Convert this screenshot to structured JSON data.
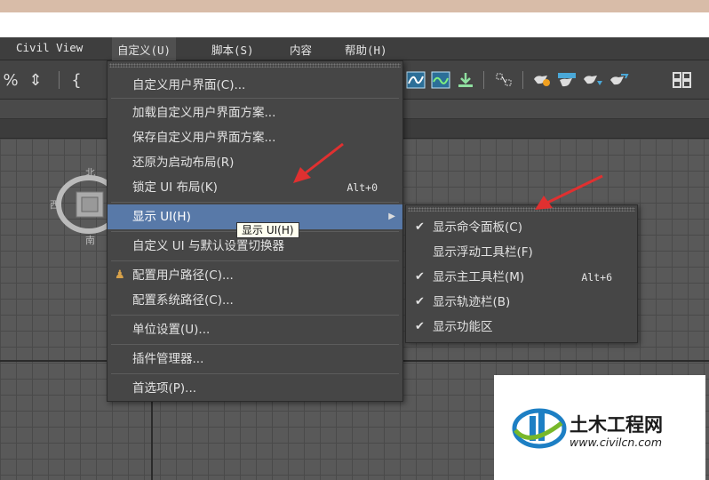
{
  "menubar": {
    "items": [
      {
        "label": "Civil View"
      },
      {
        "label": "自定义(U)"
      },
      {
        "label": "脚本(S)"
      },
      {
        "label": "内容"
      },
      {
        "label": "帮助(H)"
      }
    ]
  },
  "viewcube": {
    "north_label": "北",
    "west_label": "西",
    "south_label": "南"
  },
  "main_menu": {
    "items": [
      {
        "label": "自定义用户界面(C)..."
      },
      {
        "label": "加载自定义用户界面方案..."
      },
      {
        "label": "保存自定义用户界面方案..."
      },
      {
        "label": "还原为启动布局(R)"
      },
      {
        "label": "锁定 UI 布局(K)",
        "shortcut": "Alt+0"
      },
      {
        "label": "显示 UI(H)"
      },
      {
        "label": "自定义 UI 与默认设置切换器"
      },
      {
        "label": "配置用户路径(C)..."
      },
      {
        "label": "配置系统路径(C)..."
      },
      {
        "label": "单位设置(U)..."
      },
      {
        "label": "插件管理器..."
      },
      {
        "label": "首选项(P)..."
      }
    ]
  },
  "tooltip": "显示 UI(H)",
  "submenu": {
    "items": [
      {
        "label": "显示命令面板(C)",
        "checked": true
      },
      {
        "label": "显示浮动工具栏(F)",
        "checked": false
      },
      {
        "label": "显示主工具栏(M)",
        "checked": true,
        "shortcut": "Alt+6"
      },
      {
        "label": "显示轨迹栏(B)",
        "checked": true
      },
      {
        "label": "显示功能区",
        "checked": true
      }
    ],
    "check_glyph": "✔"
  },
  "logo": {
    "brand": "土木工程网",
    "url": "www.civilcn.com"
  },
  "colors": {
    "highlight": "#5879a8",
    "menu_bg": "#464646",
    "arrow": "#e03030"
  }
}
